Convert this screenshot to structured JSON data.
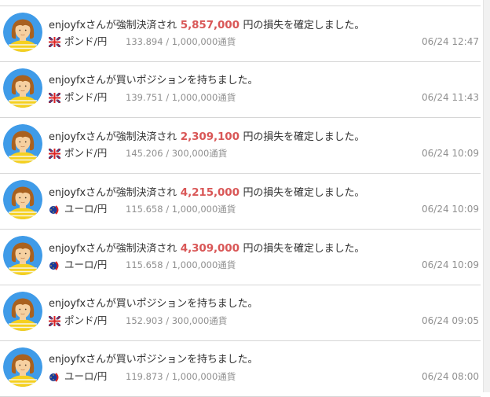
{
  "feed": {
    "items": [
      {
        "user": "enjoyfx",
        "text_before": "さんが強制決済され",
        "amount": "5,857,000",
        "text_after": "円の損失を確定しました。",
        "flag": "uk-flag-icon",
        "pair": "ポンド/円",
        "detail": "133.894 / 1,000,000通貨",
        "time": "06/24 12:47"
      },
      {
        "user": "enjoyfx",
        "text_before": "さんが買いポジションを持ちました。",
        "amount": "",
        "text_after": "",
        "flag": "uk-flag-icon",
        "pair": "ポンド/円",
        "detail": "139.751 / 1,000,000通貨",
        "time": "06/24 11:43"
      },
      {
        "user": "enjoyfx",
        "text_before": "さんが強制決済され",
        "amount": "2,309,100",
        "text_after": "円の損失を確定しました。",
        "flag": "uk-flag-icon",
        "pair": "ポンド/円",
        "detail": "145.206 / 300,000通貨",
        "time": "06/24 10:09"
      },
      {
        "user": "enjoyfx",
        "text_before": "さんが強制決済され",
        "amount": "4,215,000",
        "text_after": "円の損失を確定しました。",
        "flag": "eu-flag-icon",
        "pair": "ユーロ/円",
        "detail": "115.658 / 1,000,000通貨",
        "time": "06/24 10:09"
      },
      {
        "user": "enjoyfx",
        "text_before": "さんが強制決済され",
        "amount": "4,309,000",
        "text_after": "円の損失を確定しました。",
        "flag": "eu-flag-icon",
        "pair": "ユーロ/円",
        "detail": "115.658 / 1,000,000通貨",
        "time": "06/24 10:09"
      },
      {
        "user": "enjoyfx",
        "text_before": "さんが買いポジションを持ちました。",
        "amount": "",
        "text_after": "",
        "flag": "uk-flag-icon",
        "pair": "ポンド/円",
        "detail": "152.903 / 300,000通貨",
        "time": "06/24 09:05"
      },
      {
        "user": "enjoyfx",
        "text_before": "さんが買いポジションを持ちました。",
        "amount": "",
        "text_after": "",
        "flag": "eu-flag-icon",
        "pair": "ユーロ/円",
        "detail": "119.873 / 1,000,000通貨",
        "time": "06/24 08:00"
      }
    ]
  },
  "colors": {
    "loss_amount": "#d95757",
    "meta_gray": "#909090",
    "divider": "#d6d6d6",
    "avatar_background": "#3f9be8"
  }
}
